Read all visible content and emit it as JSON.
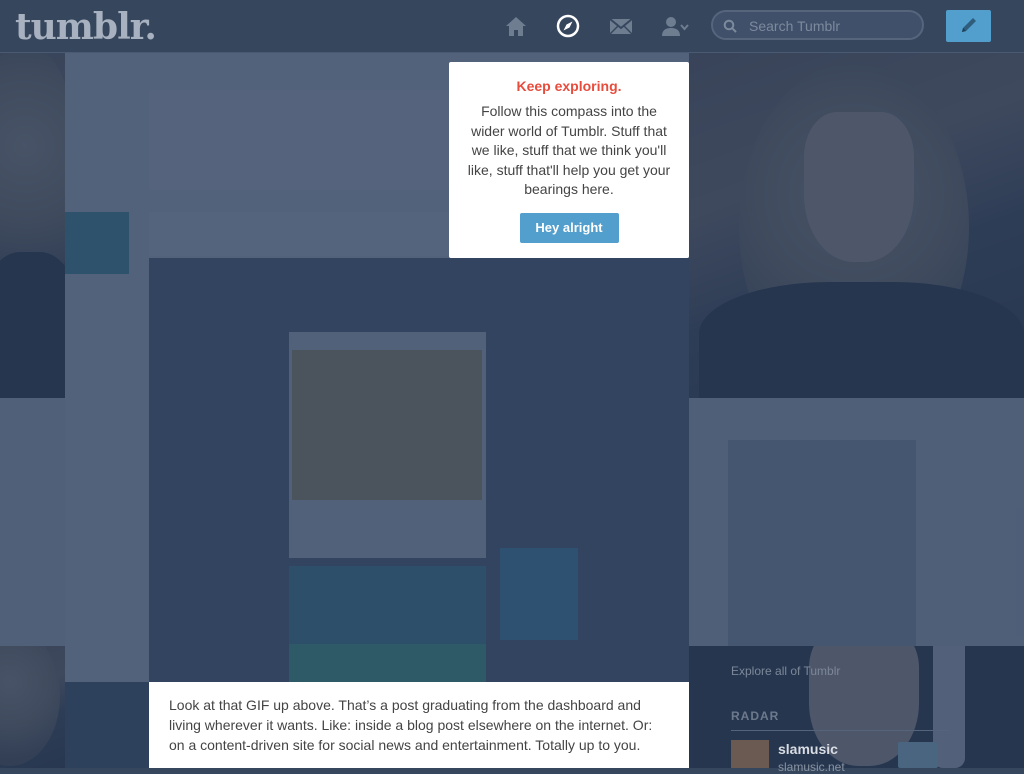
{
  "header": {
    "logo": "tumblr.",
    "search_placeholder": "Search Tumblr",
    "nav": [
      "home-icon",
      "compass-icon",
      "mail-icon",
      "account-icon"
    ]
  },
  "popover": {
    "title": "Keep exploring.",
    "body": "Follow this compass into the wider world of Tumblr. Stuff that we like, stuff that we think you'll like, stuff that'll help you get your bearings here.",
    "button": "Hey alright"
  },
  "article": {
    "text": "Look at that GIF up above. That’s a post graduating from the dashboard and living wherever it wants. Like: inside a blog post elsewhere on the internet. Or: on a content-driven site for social news and entertainment. Totally up to you."
  },
  "sidebar": {
    "explore_link": "Explore all of Tumblr",
    "radar_heading": "RADAR",
    "radar_blog_name": "slamusic",
    "radar_blog_url": "slamusic.net"
  },
  "colors": {
    "navy": "#36465d",
    "accent_blue": "#529ecc",
    "title_red": "#e74c3c"
  }
}
